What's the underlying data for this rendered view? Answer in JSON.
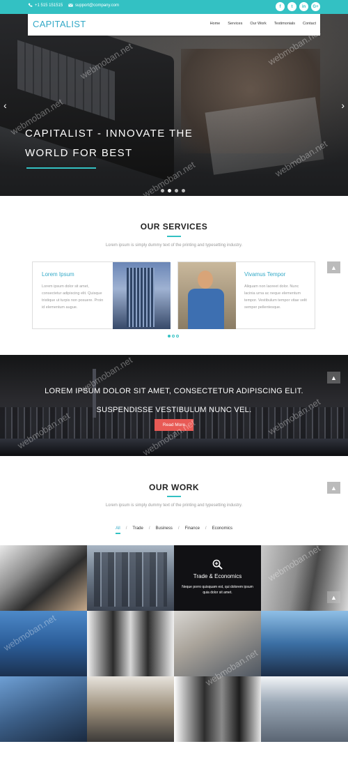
{
  "topbar": {
    "phone": "+1 515 151515",
    "email": "support@company.com",
    "social": [
      "f",
      "t",
      "in",
      "G+"
    ]
  },
  "brand": "CAPITALIST",
  "nav": [
    "Home",
    "Services",
    "Our Work",
    "Testimonials",
    "Contact"
  ],
  "hero": {
    "title": "CAPITALIST - INNOVATE THE WORLD FOR BEST",
    "slide_count": 4,
    "active_slide": 2
  },
  "services": {
    "title": "OUR SERVICES",
    "subtitle": "Lorem ipsum is simply dummy text of the printing and typesetting industry.",
    "cards": [
      {
        "title": "Lorem Ipsum",
        "text": "Lorem ipsum dolor sit amet, consectetur adipiscing elit. Quisque tristique ut turpis non posuere. Proin id elementum augue."
      },
      {
        "title": "Vivamus Tempor",
        "text": "Aliquam non laoreet dolor. Nunc lacinia urna ac neque elementum tempor. Vestibulum tempor vitae velit semper pellentesque."
      }
    ]
  },
  "banner": {
    "text": "LOREM IPSUM DOLOR SIT AMET, CONSECTETUR ADIPISCING ELIT. SUSPENDISSE VESTIBULUM NUNC VEL.",
    "button": "Read More"
  },
  "work": {
    "title": "OUR WORK",
    "subtitle": "Lorem ipsum is simply dummy text of the printing and typesetting industry.",
    "filters": [
      "All",
      "Trade",
      "Business",
      "Finance",
      "Economics"
    ],
    "active_filter": "All",
    "hover_tile": {
      "title": "Trade & Economics",
      "text": "Neque porro quisquam est, qui dolorem ipsum quia dolor sit amet."
    }
  },
  "watermark": "webmoban.net",
  "colors": {
    "accent": "#33c1c3",
    "link": "#33a9c7",
    "button": "#e85a55"
  }
}
